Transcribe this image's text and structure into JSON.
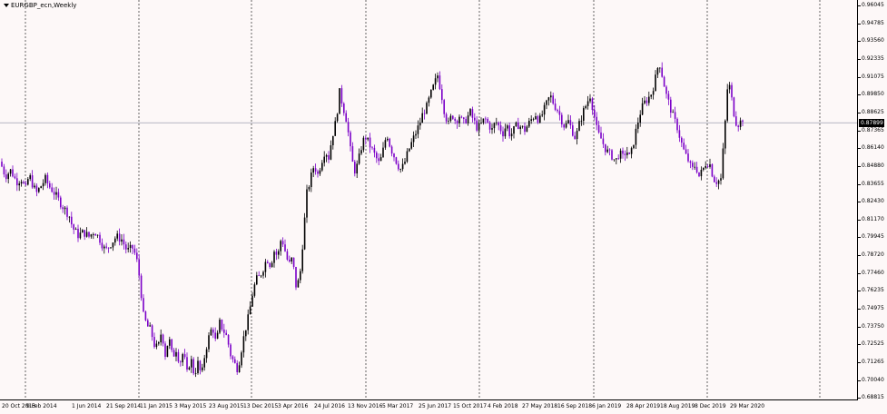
{
  "window": {
    "symbol_title": "EURGBP_ecn,Weekly"
  },
  "colors": {
    "background": "#fdf8f8",
    "bull_candle": "#000000",
    "bear_candle": "#7b00c8",
    "grid_line": "#000000",
    "current_price_line": "#a0a0b0",
    "current_price_label_bg": "#000000"
  },
  "price_axis": {
    "labels": [
      "0.96045",
      "0.94785",
      "0.93560",
      "0.92335",
      "0.91075",
      "0.89850",
      "0.88625",
      "0.87365",
      "0.86140",
      "0.84880",
      "0.83655",
      "0.82430",
      "0.81170",
      "0.79945",
      "0.78720",
      "0.77460",
      "0.76235",
      "0.74975",
      "0.73750",
      "0.72525",
      "0.71265",
      "0.70040",
      "0.68815"
    ],
    "current_price": "0.87899"
  },
  "time_axis": {
    "labels": [
      "20 Oct 2013",
      "9 Feb 2014",
      "1 Jun 2014",
      "21 Sep 2014",
      "11 Jan 2015",
      "3 May 2015",
      "23 Aug 2015",
      "13 Dec 2015",
      "3 Apr 2016",
      "24 Jul 2016",
      "13 Nov 2016",
      "5 Mar 2017",
      "25 Jun 2017",
      "15 Oct 2017",
      "4 Feb 2018",
      "27 May 2018",
      "16 Sep 2018",
      "6 Jan 2019",
      "28 Apr 2019",
      "18 Aug 2019",
      "8 Dec 2019",
      "29 Mar 2020"
    ]
  },
  "chart_data": {
    "type": "candlestick",
    "symbol": "EURGBP_ecn",
    "timeframe": "Weekly",
    "ylim": [
      0.68815,
      0.96045
    ],
    "current_price": 0.87899,
    "x_ticks": [
      "20 Oct 2013",
      "9 Feb 2014",
      "1 Jun 2014",
      "21 Sep 2014",
      "11 Jan 2015",
      "3 May 2015",
      "23 Aug 2015",
      "13 Dec 2015",
      "3 Apr 2016",
      "24 Jul 2016",
      "13 Nov 2016",
      "5 Mar 2017",
      "25 Jun 2017",
      "15 Oct 2017",
      "4 Feb 2018",
      "27 May 2018",
      "16 Sep 2018",
      "6 Jan 2019",
      "28 Apr 2019",
      "18 Aug 2019",
      "8 Dec 2019",
      "29 Mar 2020"
    ],
    "y_ticks": [
      0.96045,
      0.94785,
      0.9356,
      0.92335,
      0.91075,
      0.8985,
      0.88625,
      0.87365,
      0.8614,
      0.8488,
      0.83655,
      0.8243,
      0.8117,
      0.79945,
      0.7872,
      0.7746,
      0.76235,
      0.74975,
      0.7375,
      0.72525,
      0.71265,
      0.7004,
      0.68815
    ],
    "close_path": [
      [
        0,
        0.852
      ],
      [
        6,
        0.842
      ],
      [
        12,
        0.846
      ],
      [
        18,
        0.838
      ],
      [
        24,
        0.84
      ],
      [
        28,
        0.832
      ],
      [
        32,
        0.843
      ],
      [
        36,
        0.836
      ],
      [
        40,
        0.83
      ],
      [
        46,
        0.836
      ],
      [
        50,
        0.84
      ],
      [
        54,
        0.835
      ],
      [
        58,
        0.832
      ],
      [
        64,
        0.826
      ],
      [
        70,
        0.82
      ],
      [
        76,
        0.815
      ],
      [
        80,
        0.806
      ],
      [
        86,
        0.801
      ],
      [
        92,
        0.803
      ],
      [
        98,
        0.8
      ],
      [
        104,
        0.804
      ],
      [
        110,
        0.798
      ],
      [
        116,
        0.79
      ],
      [
        122,
        0.795
      ],
      [
        128,
        0.8
      ],
      [
        134,
        0.798
      ],
      [
        140,
        0.79
      ],
      [
        146,
        0.792
      ],
      [
        150,
        0.786
      ],
      [
        154,
        0.77
      ],
      [
        158,
        0.745
      ],
      [
        162,
        0.738
      ],
      [
        166,
        0.735
      ],
      [
        170,
        0.725
      ],
      [
        174,
        0.722
      ],
      [
        178,
        0.735
      ],
      [
        182,
        0.718
      ],
      [
        186,
        0.73
      ],
      [
        190,
        0.716
      ],
      [
        194,
        0.722
      ],
      [
        198,
        0.712
      ],
      [
        202,
        0.72
      ],
      [
        206,
        0.705
      ],
      [
        210,
        0.716
      ],
      [
        214,
        0.704
      ],
      [
        218,
        0.712
      ],
      [
        222,
        0.703
      ],
      [
        226,
        0.72
      ],
      [
        230,
        0.73
      ],
      [
        234,
        0.738
      ],
      [
        238,
        0.725
      ],
      [
        242,
        0.74
      ],
      [
        246,
        0.735
      ],
      [
        250,
        0.73
      ],
      [
        254,
        0.718
      ],
      [
        258,
        0.712
      ],
      [
        262,
        0.708
      ],
      [
        266,
        0.722
      ],
      [
        270,
        0.735
      ],
      [
        274,
        0.745
      ],
      [
        278,
        0.76
      ],
      [
        282,
        0.77
      ],
      [
        286,
        0.772
      ],
      [
        290,
        0.778
      ],
      [
        294,
        0.785
      ],
      [
        298,
        0.78
      ],
      [
        302,
        0.79
      ],
      [
        306,
        0.786
      ],
      [
        310,
        0.8
      ],
      [
        314,
        0.79
      ],
      [
        318,
        0.78
      ],
      [
        322,
        0.785
      ],
      [
        326,
        0.766
      ],
      [
        330,
        0.77
      ],
      [
        334,
        0.8
      ],
      [
        338,
        0.83
      ],
      [
        342,
        0.84
      ],
      [
        346,
        0.85
      ],
      [
        350,
        0.843
      ],
      [
        354,
        0.852
      ],
      [
        358,
        0.86
      ],
      [
        362,
        0.855
      ],
      [
        366,
        0.87
      ],
      [
        370,
        0.88
      ],
      [
        374,
        0.9
      ],
      [
        378,
        0.89
      ],
      [
        382,
        0.88
      ],
      [
        386,
        0.86
      ],
      [
        390,
        0.845
      ],
      [
        394,
        0.85
      ],
      [
        398,
        0.862
      ],
      [
        402,
        0.87
      ],
      [
        406,
        0.865
      ],
      [
        410,
        0.86
      ],
      [
        414,
        0.855
      ],
      [
        418,
        0.85
      ],
      [
        422,
        0.86
      ],
      [
        426,
        0.872
      ],
      [
        430,
        0.862
      ],
      [
        434,
        0.856
      ],
      [
        438,
        0.85
      ],
      [
        442,
        0.846
      ],
      [
        446,
        0.852
      ],
      [
        450,
        0.86
      ],
      [
        454,
        0.866
      ],
      [
        458,
        0.872
      ],
      [
        462,
        0.878
      ],
      [
        466,
        0.886
      ],
      [
        470,
        0.89
      ],
      [
        474,
        0.898
      ],
      [
        478,
        0.905
      ],
      [
        482,
        0.912
      ],
      [
        486,
        0.9
      ],
      [
        490,
        0.885
      ],
      [
        494,
        0.878
      ],
      [
        498,
        0.885
      ],
      [
        502,
        0.88
      ],
      [
        506,
        0.884
      ],
      [
        510,
        0.878
      ],
      [
        514,
        0.882
      ],
      [
        518,
        0.886
      ],
      [
        522,
        0.88
      ],
      [
        526,
        0.875
      ],
      [
        530,
        0.878
      ],
      [
        534,
        0.882
      ],
      [
        538,
        0.878
      ],
      [
        542,
        0.874
      ],
      [
        546,
        0.88
      ],
      [
        550,
        0.876
      ],
      [
        554,
        0.872
      ],
      [
        558,
        0.878
      ],
      [
        562,
        0.87
      ],
      [
        566,
        0.874
      ],
      [
        570,
        0.878
      ],
      [
        574,
        0.876
      ],
      [
        578,
        0.874
      ],
      [
        582,
        0.878
      ],
      [
        586,
        0.882
      ],
      [
        590,
        0.885
      ],
      [
        594,
        0.88
      ],
      [
        598,
        0.886
      ],
      [
        602,
        0.892
      ],
      [
        606,
        0.898
      ],
      [
        610,
        0.892
      ],
      [
        614,
        0.888
      ],
      [
        618,
        0.882
      ],
      [
        622,
        0.876
      ],
      [
        626,
        0.88
      ],
      [
        630,
        0.874
      ],
      [
        634,
        0.868
      ],
      [
        638,
        0.878
      ],
      [
        642,
        0.886
      ],
      [
        646,
        0.892
      ],
      [
        650,
        0.898
      ],
      [
        654,
        0.886
      ],
      [
        658,
        0.872
      ],
      [
        662,
        0.868
      ],
      [
        666,
        0.862
      ],
      [
        670,
        0.858
      ],
      [
        674,
        0.856
      ],
      [
        678,
        0.852
      ],
      [
        682,
        0.858
      ],
      [
        686,
        0.855
      ],
      [
        690,
        0.86
      ],
      [
        694,
        0.854
      ],
      [
        698,
        0.866
      ],
      [
        702,
        0.878
      ],
      [
        706,
        0.888
      ],
      [
        710,
        0.893
      ],
      [
        714,
        0.896
      ],
      [
        718,
        0.9
      ],
      [
        722,
        0.91
      ],
      [
        726,
        0.922
      ],
      [
        730,
        0.91
      ],
      [
        734,
        0.898
      ],
      [
        738,
        0.89
      ],
      [
        742,
        0.882
      ],
      [
        746,
        0.876
      ],
      [
        750,
        0.866
      ],
      [
        754,
        0.858
      ],
      [
        758,
        0.853
      ],
      [
        762,
        0.846
      ],
      [
        766,
        0.85
      ],
      [
        770,
        0.842
      ],
      [
        774,
        0.846
      ],
      [
        778,
        0.852
      ],
      [
        782,
        0.85
      ],
      [
        786,
        0.84
      ],
      [
        790,
        0.838
      ],
      [
        794,
        0.84
      ],
      [
        798,
        0.872
      ],
      [
        802,
        0.91
      ],
      [
        806,
        0.895
      ],
      [
        810,
        0.88
      ],
      [
        814,
        0.878
      ],
      [
        818,
        0.882
      ]
    ]
  }
}
